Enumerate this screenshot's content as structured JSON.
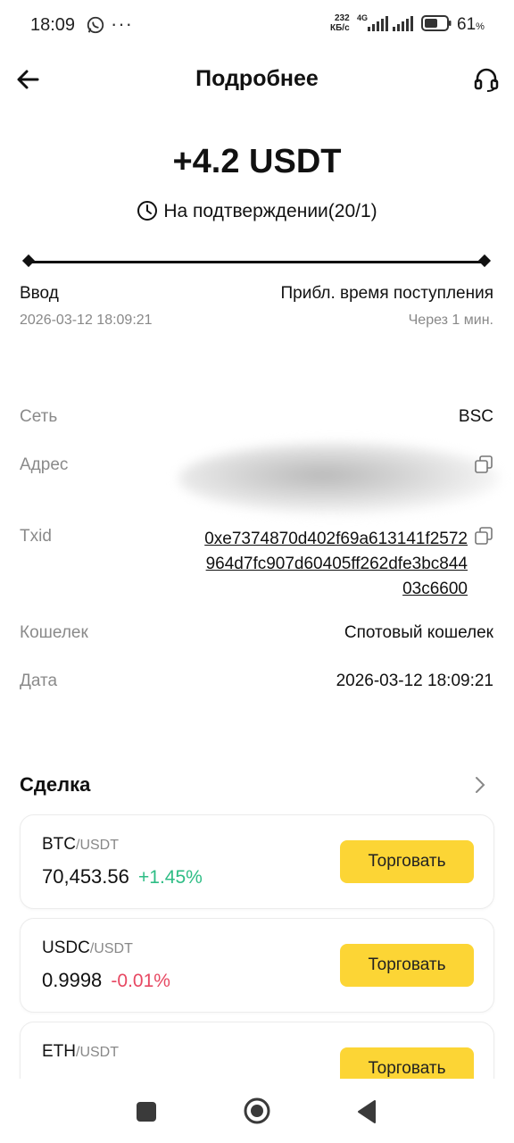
{
  "status_bar": {
    "time": "18:09",
    "dots": "···",
    "net_speed_value": "232",
    "net_speed_unit": "КБ/с",
    "network": "4G",
    "battery_percent": "61",
    "battery_unit": "%",
    "battery_level": 0.61
  },
  "header": {
    "title": "Подробнее",
    "back_icon": "arrow-left-icon",
    "support_icon": "headset-icon"
  },
  "transaction": {
    "amount": "+4.2 USDT",
    "status": "На подтверждении(20/1)",
    "progress_left_label": "Ввод",
    "progress_left_time": "2026-03-12 18:09:21",
    "progress_right_label": "Прибл. время поступления",
    "progress_right_time": "Через 1 мин."
  },
  "details": {
    "network_label": "Сеть",
    "network_value": "BSC",
    "address_label": "Адрес",
    "address_value": "",
    "txid_label": "Txid",
    "txid_value": "0xe7374870d402f69a613141f2572964d7fc907d60405ff262dfe3bc84403c6600",
    "wallet_label": "Кошелек",
    "wallet_value": "Спотовый кошелек",
    "date_label": "Дата",
    "date_value": "2026-03-12 18:09:21"
  },
  "trade_section": {
    "title": "Сделка",
    "trade_button_label": "Торговать",
    "pairs": [
      {
        "base": "BTC",
        "quote": "/USDT",
        "price": "70,453.56",
        "change": "+1.45%"
      },
      {
        "base": "USDC",
        "quote": "/USDT",
        "price": "0.9998",
        "change": "-0.01%"
      },
      {
        "base": "ETH",
        "quote": "/USDT",
        "price": "",
        "change": ""
      }
    ]
  },
  "colors": {
    "accent_yellow": "#fcd535",
    "positive": "#2ebd85",
    "negative": "#e74862"
  }
}
